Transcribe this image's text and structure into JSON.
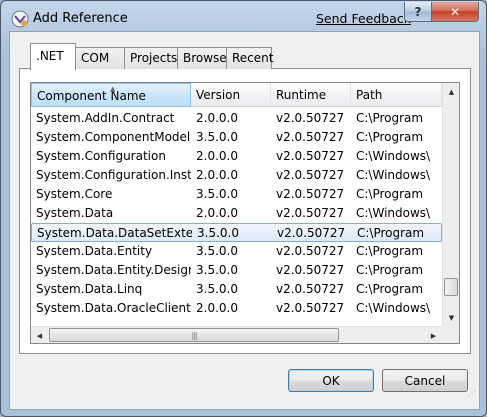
{
  "window": {
    "title": "Add Reference",
    "send_feedback": "Send Feedback",
    "help_label": "?",
    "close_label": "✕"
  },
  "tabs": [
    {
      "label": ".NET",
      "active": true
    },
    {
      "label": "COM",
      "active": false
    },
    {
      "label": "Projects",
      "active": false
    },
    {
      "label": "Browse",
      "active": false
    },
    {
      "label": "Recent",
      "active": false
    }
  ],
  "list": {
    "columns": [
      "Component Name",
      "Version",
      "Runtime",
      "Path"
    ],
    "sorted_column": "Component Name",
    "rows": [
      {
        "name": "System.AddIn.Contract",
        "version": "2.0.0.0",
        "runtime": "v2.0.50727",
        "path": "C:\\Program"
      },
      {
        "name": "System.ComponentModel...",
        "version": "3.5.0.0",
        "runtime": "v2.0.50727",
        "path": "C:\\Program"
      },
      {
        "name": "System.Configuration",
        "version": "2.0.0.0",
        "runtime": "v2.0.50727",
        "path": "C:\\Windows\\"
      },
      {
        "name": "System.Configuration.Install",
        "version": "2.0.0.0",
        "runtime": "v2.0.50727",
        "path": "C:\\Windows\\"
      },
      {
        "name": "System.Core",
        "version": "3.5.0.0",
        "runtime": "v2.0.50727",
        "path": "C:\\Program"
      },
      {
        "name": "System.Data",
        "version": "2.0.0.0",
        "runtime": "v2.0.50727",
        "path": "C:\\Windows\\"
      },
      {
        "name": "System.Data.DataSetExtens...",
        "version": "3.5.0.0",
        "runtime": "v2.0.50727",
        "path": "C:\\Program",
        "selected": true
      },
      {
        "name": "System.Data.Entity",
        "version": "3.5.0.0",
        "runtime": "v2.0.50727",
        "path": "C:\\Program"
      },
      {
        "name": "System.Data.Entity.Design",
        "version": "3.5.0.0",
        "runtime": "v2.0.50727",
        "path": "C:\\Program"
      },
      {
        "name": "System.Data.Linq",
        "version": "3.5.0.0",
        "runtime": "v2.0.50727",
        "path": "C:\\Program"
      },
      {
        "name": "System.Data.OracleClient",
        "version": "2.0.0.0",
        "runtime": "v2.0.50727",
        "path": "C:\\Windows\\"
      }
    ]
  },
  "buttons": {
    "ok": "OK",
    "cancel": "Cancel"
  },
  "colors": {
    "selection_border": "#84acdd",
    "selection_fill": "#dcebfb",
    "close_red": "#c0412a"
  }
}
